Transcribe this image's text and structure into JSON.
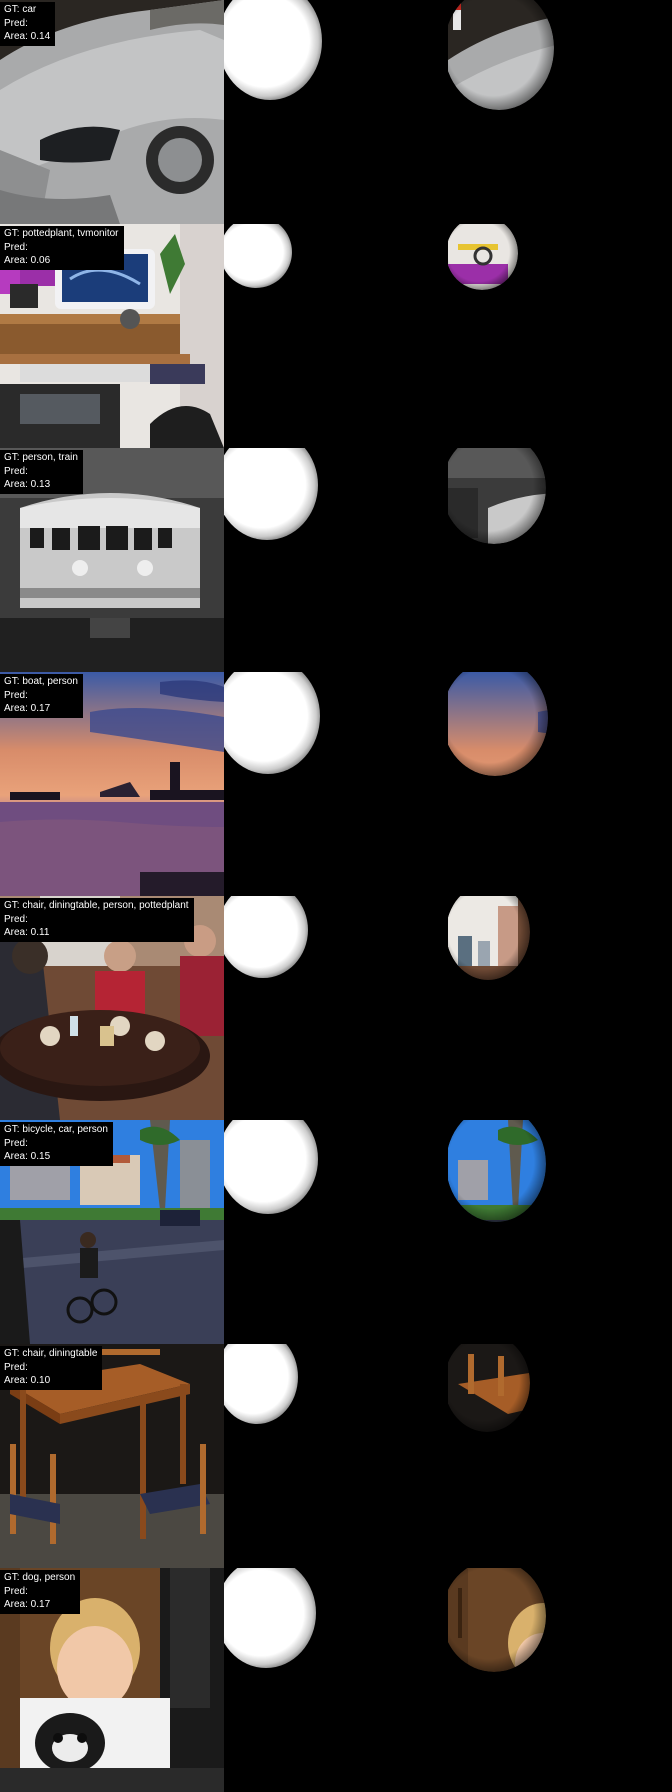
{
  "rows": [
    {
      "gt": "GT: car",
      "pred": "Pred:",
      "area": "Area: 0.14",
      "scene": "car"
    },
    {
      "gt": "GT: pottedplant, tvmonitor",
      "pred": "Pred:",
      "area": "Area: 0.06",
      "scene": "desk"
    },
    {
      "gt": "GT: person, train",
      "pred": "Pred:",
      "area": "Area: 0.13",
      "scene": "train"
    },
    {
      "gt": "GT: boat, person",
      "pred": "Pred:",
      "area": "Area: 0.17",
      "scene": "sunset"
    },
    {
      "gt": "GT: chair, diningtable, person, pottedplant",
      "pred": "Pred:",
      "area": "Area: 0.11",
      "scene": "restaurant"
    },
    {
      "gt": "GT: bicycle, car, person",
      "pred": "Pred:",
      "area": "Area: 0.15",
      "scene": "street"
    },
    {
      "gt": "GT: chair, diningtable",
      "pred": "Pred:",
      "area": "Area: 0.10",
      "scene": "table"
    },
    {
      "gt": "GT: dog, person",
      "pred": "Pred:",
      "area": "Area: 0.17",
      "scene": "child"
    }
  ]
}
